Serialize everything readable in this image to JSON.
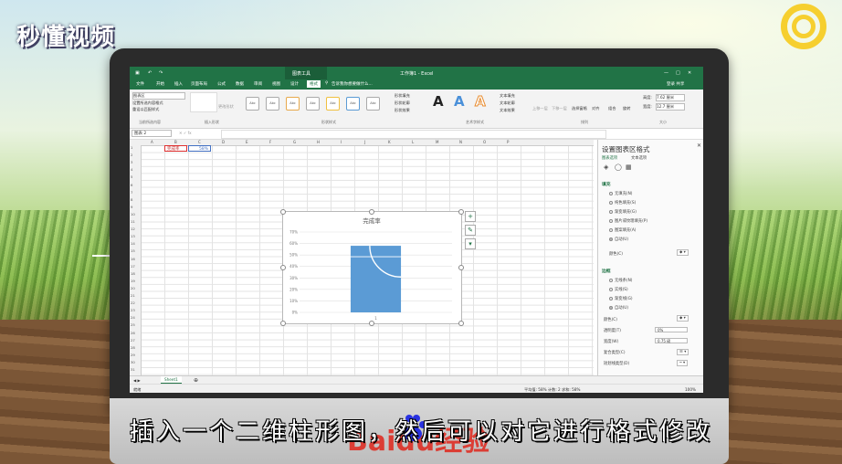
{
  "overlay": {
    "logo": "秒懂视频",
    "subtitle": "插入一个二维柱形图，然后可以对它进行格式修改",
    "watermark": "Baidu经验"
  },
  "excel": {
    "context_tab": "图表工具",
    "search_hint": "告诉我你想要做什么...",
    "window_title": "工作簿1 - Excel",
    "user": "登录  共享",
    "tabs": [
      "文件",
      "开始",
      "插入",
      "页面布局",
      "公式",
      "数据",
      "审阅",
      "视图",
      "设计",
      "格式"
    ],
    "active_tab": "格式",
    "ribbon": {
      "selection_box": "图表区",
      "format_selection": "设置所选内容格式",
      "reset_style": "重设以匹配样式",
      "change_shape": "更改形状",
      "style_btn": "Abc",
      "shape_fill": "形状填充",
      "shape_outline": "形状轮廓",
      "shape_effects": "形状效果",
      "text_fill": "文本填充",
      "text_outline": "文本轮廓",
      "text_effects": "文本效果",
      "art_letter": "A",
      "bring_forward": "上移一层",
      "send_backward": "下移一层",
      "selection_pane": "选择窗格",
      "align": "对齐",
      "group": "组合",
      "rotate": "旋转",
      "height_label": "高度:",
      "height_value": "7.62 厘米",
      "width_label": "宽度:",
      "width_value": "12.7 厘米",
      "group_labels": [
        "当前所选内容",
        "插入形状",
        "形状样式",
        "艺术字样式",
        "排列",
        "大小"
      ]
    },
    "name_box": "图表 2",
    "columns": [
      "A",
      "B",
      "C",
      "D",
      "E",
      "F",
      "G",
      "H",
      "I",
      "J",
      "K",
      "L",
      "M",
      "N",
      "O",
      "P"
    ],
    "rows": [
      "1",
      "2",
      "3",
      "4",
      "5",
      "6",
      "7",
      "8",
      "9",
      "10",
      "11",
      "12",
      "13",
      "14",
      "15",
      "16",
      "17",
      "18",
      "19",
      "20",
      "21",
      "22",
      "23",
      "24",
      "25",
      "26",
      "27",
      "28",
      "29",
      "30",
      "31"
    ],
    "cells": {
      "B1": "完成率",
      "C1": "58%"
    },
    "sheet_tab": "Sheet1",
    "status_ready": "就绪",
    "status_stats": "平均值: 58%    计数: 2    求和: 58%",
    "zoom": "100%"
  },
  "chart_data": {
    "type": "bar",
    "title": "完成率",
    "categories": [
      "1"
    ],
    "values": [
      0.58
    ],
    "ylim": [
      0,
      0.7
    ],
    "yticks": [
      "0%",
      "10%",
      "20%",
      "30%",
      "40%",
      "50%",
      "60%",
      "70%"
    ],
    "grid": true,
    "bar_color": "#5b9bd5"
  },
  "pane": {
    "title": "设置图表区格式",
    "subtabs": [
      "图表选项",
      "文本选项"
    ],
    "fill_section": "填充",
    "fill_options": [
      "无填充(N)",
      "纯色填充(S)",
      "渐变填充(G)",
      "图片或纹理填充(P)",
      "图案填充(A)",
      "自动(U)"
    ],
    "fill_color": "颜色(C)",
    "border_section": "边框",
    "border_options": [
      "无线条(N)",
      "实线(S)",
      "渐变线(G)",
      "自动(U)"
    ],
    "border_color": "颜色(C)",
    "transparency": "透明度(T)",
    "transparency_value": "0%",
    "width": "宽度(W)",
    "width_value": "0.75 磅",
    "compound": "复合类型(C)",
    "dash": "短划线类型(D)"
  }
}
